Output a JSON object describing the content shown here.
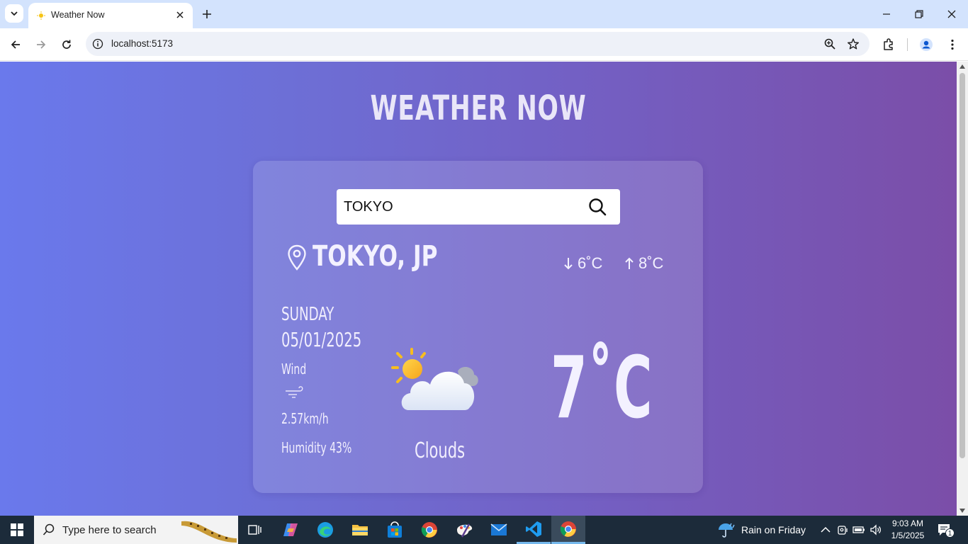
{
  "browser": {
    "tab_title": "Weather Now",
    "url": "localhost:5173"
  },
  "app": {
    "title": "WEATHER NOW",
    "search_value": "TOKYO",
    "location": "TOKYO, JP",
    "temp_min": "6˚C",
    "temp_max": "8˚C",
    "day": "SUNDAY",
    "date": "05/01/2025",
    "wind_label": "Wind",
    "wind_value": "2.57km/h",
    "humidity": "Humidity 43%",
    "condition": "Clouds",
    "temperature": "7˚C"
  },
  "taskbar": {
    "search_placeholder": "Type here to search",
    "weather": "Rain on Friday",
    "time": "9:03 AM",
    "date": "1/5/2025",
    "notification_count": "1"
  }
}
